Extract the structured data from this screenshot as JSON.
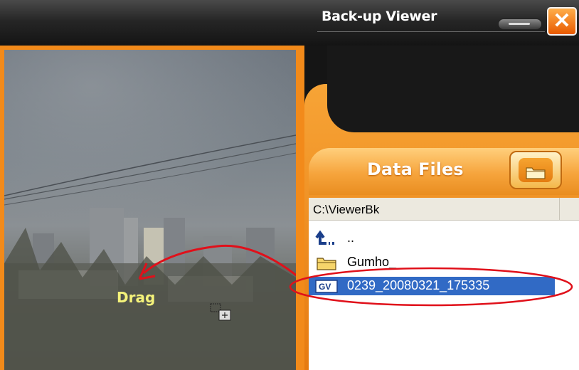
{
  "window": {
    "title": "Back-up Viewer"
  },
  "video": {
    "overlay_label": "Drag"
  },
  "panel": {
    "header_title": "Data Files",
    "path": "C:\\ViewerBk",
    "items": [
      {
        "label": "..",
        "icon": "up-folder-icon"
      },
      {
        "label": "Gumho_",
        "icon": "folder-icon"
      },
      {
        "label": "0239_20080321_175335",
        "icon": "video-file-icon",
        "selected": true
      }
    ]
  },
  "colors": {
    "accent": "#f08a18",
    "selection": "#316ac5",
    "annotation": "#e0101a"
  }
}
